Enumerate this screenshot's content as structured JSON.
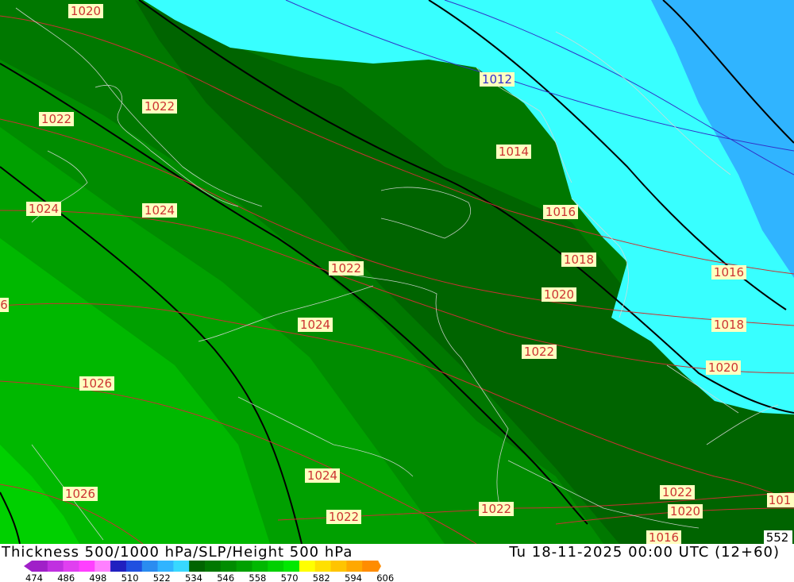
{
  "title_left": "Thickness 500/1000 hPa/SLP/Height 500 hPa",
  "title_right": "Tu 18-11-2025 00:00 UTC (12+60)",
  "scale": {
    "colors": [
      "#a020c8",
      "#c030e0",
      "#e040f0",
      "#ff40ff",
      "#ff80ff",
      "#2020c0",
      "#2050e0",
      "#2a8cf0",
      "#30b4ff",
      "#38d8ff",
      "#006400",
      "#007800",
      "#008c00",
      "#00a000",
      "#00b800",
      "#00d000",
      "#00e800",
      "#ffff00",
      "#ffe000",
      "#ffc400",
      "#ffa800",
      "#ff8c00"
    ],
    "ticks": [
      "474",
      "486",
      "498",
      "510",
      "522",
      "534",
      "546",
      "558",
      "570",
      "582",
      "594",
      "606"
    ]
  },
  "isobar_labels": [
    {
      "text": "1020",
      "color": "#cc3333"
    },
    {
      "text": "1022",
      "color": "#cc3333"
    },
    {
      "text": "1022",
      "color": "#cc3333"
    },
    {
      "text": "1024",
      "color": "#cc3333"
    },
    {
      "text": "1024",
      "color": "#cc3333"
    },
    {
      "text": "6",
      "color": "#cc3333"
    },
    {
      "text": "1026",
      "color": "#cc3333"
    },
    {
      "text": "1026",
      "color": "#cc3333"
    },
    {
      "text": "1024",
      "color": "#cc3333"
    },
    {
      "text": "1022",
      "color": "#cc3333"
    },
    {
      "text": "1012",
      "color": "#3333cc"
    },
    {
      "text": "1014",
      "color": "#cc3333"
    },
    {
      "text": "1016",
      "color": "#cc3333"
    },
    {
      "text": "1018",
      "color": "#cc3333"
    },
    {
      "text": "1020",
      "color": "#cc3333"
    },
    {
      "text": "1022",
      "color": "#cc3333"
    },
    {
      "text": "1024",
      "color": "#cc3333"
    },
    {
      "text": "1022",
      "color": "#cc3333"
    },
    {
      "text": "1022",
      "color": "#cc3333"
    },
    {
      "text": "1022",
      "color": "#cc3333"
    },
    {
      "text": "1020",
      "color": "#cc3333"
    },
    {
      "text": "1016",
      "color": "#cc3333"
    },
    {
      "text": "1016",
      "color": "#cc3333"
    },
    {
      "text": "1018",
      "color": "#cc3333"
    },
    {
      "text": "1020",
      "color": "#cc3333"
    },
    {
      "text": "101",
      "color": "#cc3333"
    },
    {
      "text": "552",
      "color": "#000000"
    }
  ]
}
